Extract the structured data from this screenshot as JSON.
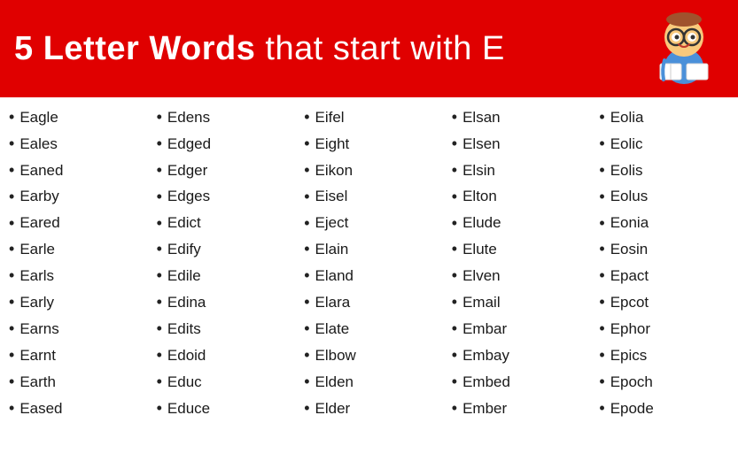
{
  "header": {
    "title_bold": "5 Letter Words",
    "title_normal": " that start with E"
  },
  "columns": [
    {
      "words": [
        "Eagle",
        "Eales",
        "Eaned",
        "Earby",
        "Eared",
        "Earle",
        "Earls",
        "Early",
        "Earns",
        "Earnt",
        "Earth",
        "Eased"
      ]
    },
    {
      "words": [
        "Edens",
        "Edged",
        "Edger",
        "Edges",
        "Edict",
        "Edify",
        "Edile",
        "Edina",
        "Edits",
        "Edoid",
        "Educ",
        "Educe"
      ]
    },
    {
      "words": [
        "Eifel",
        "Eight",
        "Eikon",
        "Eisel",
        "Eject",
        "Elain",
        "Eland",
        "Elara",
        "Elate",
        "Elbow",
        "Elden",
        "Elder"
      ]
    },
    {
      "words": [
        "Elsan",
        "Elsen",
        "Elsin",
        "Elton",
        "Elude",
        "Elute",
        "Elven",
        "Email",
        "Embar",
        "Embay",
        "Embed",
        "Ember"
      ]
    },
    {
      "words": [
        "Eolia",
        "Eolic",
        "Eolis",
        "Eolus",
        "Eonia",
        "Eosin",
        "Epact",
        "Epcot",
        "Ephor",
        "Epics",
        "Epoch",
        "Epode"
      ]
    }
  ]
}
